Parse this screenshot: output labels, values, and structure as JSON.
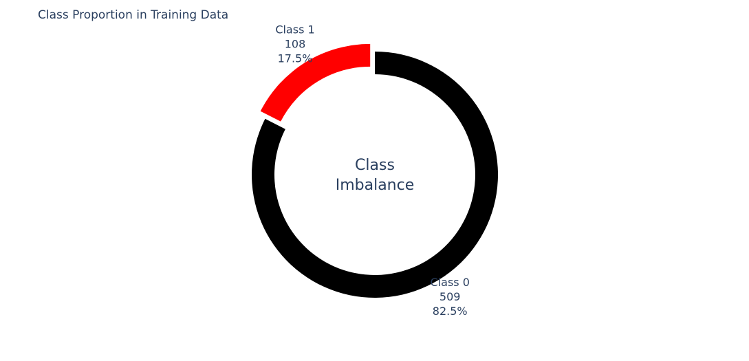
{
  "chart_data": {
    "type": "pie",
    "title": "Class Proportion in Training Data",
    "hole_annotation": [
      "Class",
      "Imbalance"
    ],
    "slices": [
      {
        "label": "Class 0",
        "value": 509,
        "percent": "82.5%",
        "color": "#000000"
      },
      {
        "label": "Class 1",
        "value": 108,
        "percent": "17.5%",
        "color": "#ff0000"
      }
    ],
    "pulled_slice": "Class 1",
    "legend": "none"
  }
}
